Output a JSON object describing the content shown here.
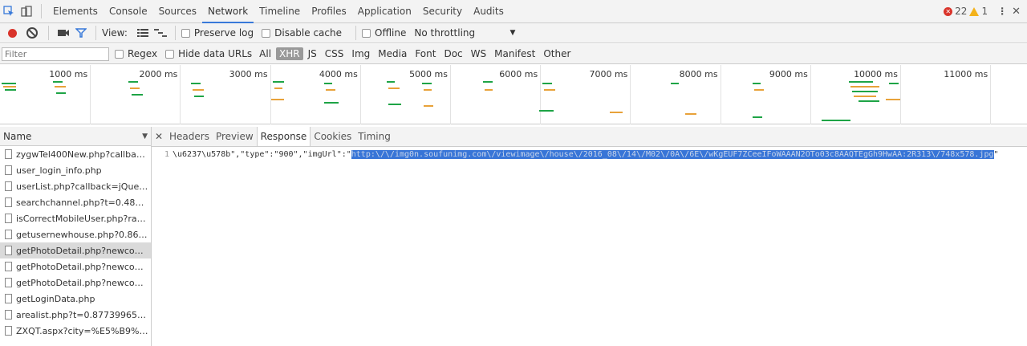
{
  "devtools_tabs": [
    "Elements",
    "Console",
    "Sources",
    "Network",
    "Timeline",
    "Profiles",
    "Application",
    "Security",
    "Audits"
  ],
  "active_tab": "Network",
  "error_count": "22",
  "warning_count": "1",
  "network_toolbar": {
    "view_label": "View:",
    "preserve_log": "Preserve log",
    "disable_cache": "Disable cache",
    "offline": "Offline",
    "throttling": "No throttling"
  },
  "filter_bar": {
    "placeholder": "Filter",
    "regex": "Regex",
    "hide_data_urls": "Hide data URLs",
    "types": [
      "All",
      "XHR",
      "JS",
      "CSS",
      "Img",
      "Media",
      "Font",
      "Doc",
      "WS",
      "Manifest",
      "Other"
    ],
    "active_type": "XHR"
  },
  "timeline": {
    "ticks": [
      "1000 ms",
      "2000 ms",
      "3000 ms",
      "4000 ms",
      "5000 ms",
      "6000 ms",
      "7000 ms",
      "8000 ms",
      "9000 ms",
      "10000 ms",
      "11000 ms"
    ]
  },
  "requests_panel": {
    "column_header": "Name",
    "requests": [
      "zygwTel400New.php?callback=...",
      "user_login_info.php",
      "userList.php?callback=jQuery17...",
      "searchchannel.php?t=0.482555...",
      "isCorrectMobileUser.php?rand...",
      "getusernewhouse.php?0.86899...",
      "getPhotoDetail.php?newcode=...",
      "getPhotoDetail.php?newcode=...",
      "getPhotoDetail.php?newcode=...",
      "getLoginData.php",
      "arealist.php?t=0.877399652288...",
      "ZXQT.aspx?city=%E5%B9%BF%E6%..."
    ],
    "selected_index": 6
  },
  "detail_tabs": [
    "Headers",
    "Preview",
    "Response",
    "Cookies",
    "Timing"
  ],
  "active_detail_tab": "Response",
  "response": {
    "line_number": "1",
    "prefix": "\\u6237\\u578b\",\"type\":\"900\",\"imgUrl\":\"",
    "highlighted": "http:\\/\\/img0n.soufunimg.com\\/viewimage\\/house\\/2016_08\\/14\\/M02\\/0A\\/6E\\/wKgEUF7ZCeeIFoWAAAN2OTo03c8AAQTEgGh9HwAA:2R313\\/748x578.jpg",
    "suffix": "\""
  },
  "colors": {
    "record_red": "#d9342b",
    "accent_blue": "#3879d9",
    "highlight_blue": "#3875d7",
    "waterfall_green": "#1ea446",
    "waterfall_orange": "#e8a23a"
  }
}
